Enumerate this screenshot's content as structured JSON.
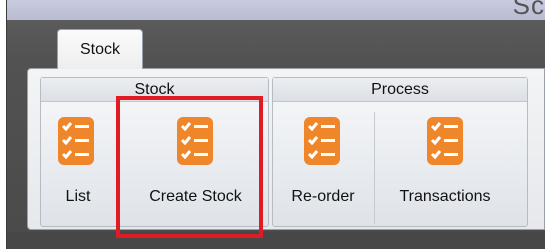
{
  "window": {
    "title_fragment": "Sc"
  },
  "tabs": [
    {
      "label": "Stock",
      "active": true
    }
  ],
  "ribbon": {
    "groups": [
      {
        "title": "Stock",
        "buttons": [
          {
            "label": "List",
            "icon": "checklist-icon"
          },
          {
            "label": "Create Stock",
            "icon": "checklist-icon"
          }
        ]
      },
      {
        "title": "Process",
        "buttons": [
          {
            "label": "Re-order",
            "icon": "checklist-icon"
          },
          {
            "label": "Transactions",
            "icon": "checklist-icon"
          }
        ]
      }
    ]
  },
  "highlight": {
    "target": "Create Stock",
    "color": "#e01b24"
  },
  "colors": {
    "icon_orange": "#f0862a",
    "icon_check": "#ffffff"
  }
}
